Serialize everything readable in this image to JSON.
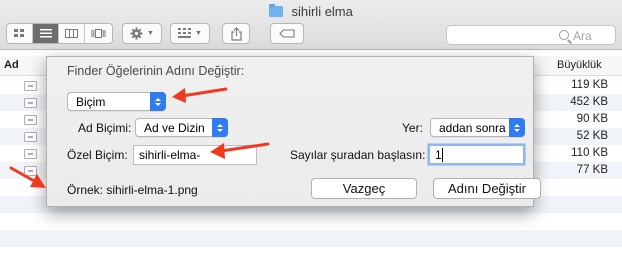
{
  "window": {
    "title": "sihirli elma",
    "search_placeholder": "Ara"
  },
  "list": {
    "columns": {
      "name": "Ad",
      "size": "Büyüklük"
    },
    "sizes": [
      "119 KB",
      "452 KB",
      "90 KB",
      "52 KB",
      "110 KB",
      "77 KB"
    ]
  },
  "dialog": {
    "title": "Finder Öğelerinin Adını Değiştir:",
    "mode_value": "Biçim",
    "format_label": "Ad Biçimi:",
    "format_value": "Ad ve Dizin",
    "where_label": "Yer:",
    "where_value": "addan sonra",
    "custom_label": "Özel Biçim:",
    "custom_value": "sihirli-elma-",
    "start_label": "Sayılar şuradan başlasın:",
    "start_value": "1",
    "example": "Örnek: sihirli-elma-1.png",
    "cancel": "Vazgeç",
    "rename": "Adını Değiştir"
  },
  "colors": {
    "accent": "#2f7cf2",
    "annotation_arrow": "#ef3a1f"
  },
  "icons": [
    "folder-icon",
    "icon-view-icon",
    "list-view-icon",
    "column-view-icon",
    "cover-flow-icon",
    "gear-icon",
    "arrange-icon",
    "share-icon",
    "tag-icon",
    "search-icon",
    "image-file-icon"
  ]
}
